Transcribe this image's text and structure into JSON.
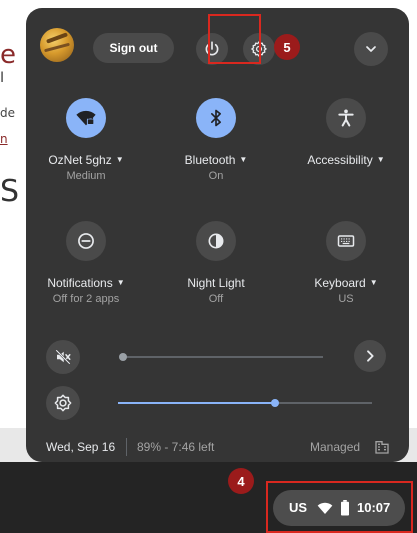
{
  "background_page": {
    "fragments": [
      "e",
      "I",
      "de",
      "n",
      "S"
    ]
  },
  "header": {
    "signout_label": "Sign out",
    "power_icon": "power-icon",
    "settings_icon": "gear-icon",
    "collapse_icon": "chevron-down-icon"
  },
  "annotations": {
    "badge_settings": "5",
    "badge_tray": "4",
    "highlight_color": "#d9281f",
    "badge_color": "#9b1b1b"
  },
  "tiles": [
    {
      "label": "OzNet 5ghz",
      "sub": "Medium",
      "icon": "wifi-lock-icon",
      "active": true,
      "has_menu": true
    },
    {
      "label": "Bluetooth",
      "sub": "On",
      "icon": "bluetooth-icon",
      "active": true,
      "has_menu": true
    },
    {
      "label": "Accessibility",
      "sub": "",
      "icon": "accessibility-icon",
      "active": false,
      "has_menu": true
    },
    {
      "label": "Notifications",
      "sub": "Off for 2 apps",
      "icon": "do-not-disturb-icon",
      "active": false,
      "has_menu": true
    },
    {
      "label": "Night Light",
      "sub": "Off",
      "icon": "night-light-icon",
      "active": false,
      "has_menu": false
    },
    {
      "label": "Keyboard",
      "sub": "US",
      "icon": "keyboard-icon",
      "active": false,
      "has_menu": true
    }
  ],
  "sliders": {
    "volume": {
      "level": 0.0,
      "muted": true,
      "icon": "volume-mute-icon"
    },
    "brightness": {
      "level": 0.62,
      "icon": "brightness-icon"
    }
  },
  "footer": {
    "date": "Wed, Sep 16",
    "battery": "89% - 7:46 left",
    "managed": "Managed",
    "managed_icon": "building-icon"
  },
  "tray": {
    "ime": "US",
    "time": "10:07",
    "wifi_icon": "wifi-icon",
    "battery_icon": "battery-icon"
  },
  "colors": {
    "panel_bg": "#353535",
    "accent": "#8ab4f8",
    "button_bg": "#4a4a4a",
    "shelf_bg": "#242424"
  }
}
